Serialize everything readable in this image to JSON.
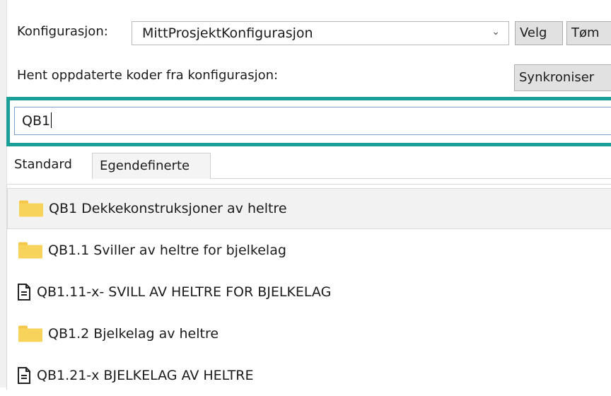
{
  "config": {
    "label": "Konfigurasjon:",
    "selected": "MittProsjektKonfigurasjon",
    "velg_label": "Velg",
    "tom_label": "Tøm"
  },
  "sync": {
    "label": "Hent oppdaterte koder fra konfigurasjon:",
    "button_label": "Synkroniser"
  },
  "search": {
    "value": "QB1"
  },
  "tabs": [
    {
      "label": "Standard",
      "active": true
    },
    {
      "label": "Egendefinerte",
      "active": false
    }
  ],
  "items": [
    {
      "type": "folder",
      "label": "QB1  Dekkekonstruksjoner av heltre",
      "selected": true
    },
    {
      "type": "folder",
      "label": "QB1.1  Sviller av heltre for bjelkelag",
      "selected": false
    },
    {
      "type": "document",
      "label": "QB1.11-x-  SVILL AV HELTRE FOR BJELKELAG",
      "selected": false
    },
    {
      "type": "folder",
      "label": "QB1.2  Bjelkelag av heltre",
      "selected": false
    },
    {
      "type": "document",
      "label": "QB1.21-x  BJELKELAG AV HELTRE",
      "selected": false
    }
  ],
  "colors": {
    "focus_border": "#1a9e98",
    "folder": "#f8d35c",
    "selection": "#f2f2f2"
  }
}
